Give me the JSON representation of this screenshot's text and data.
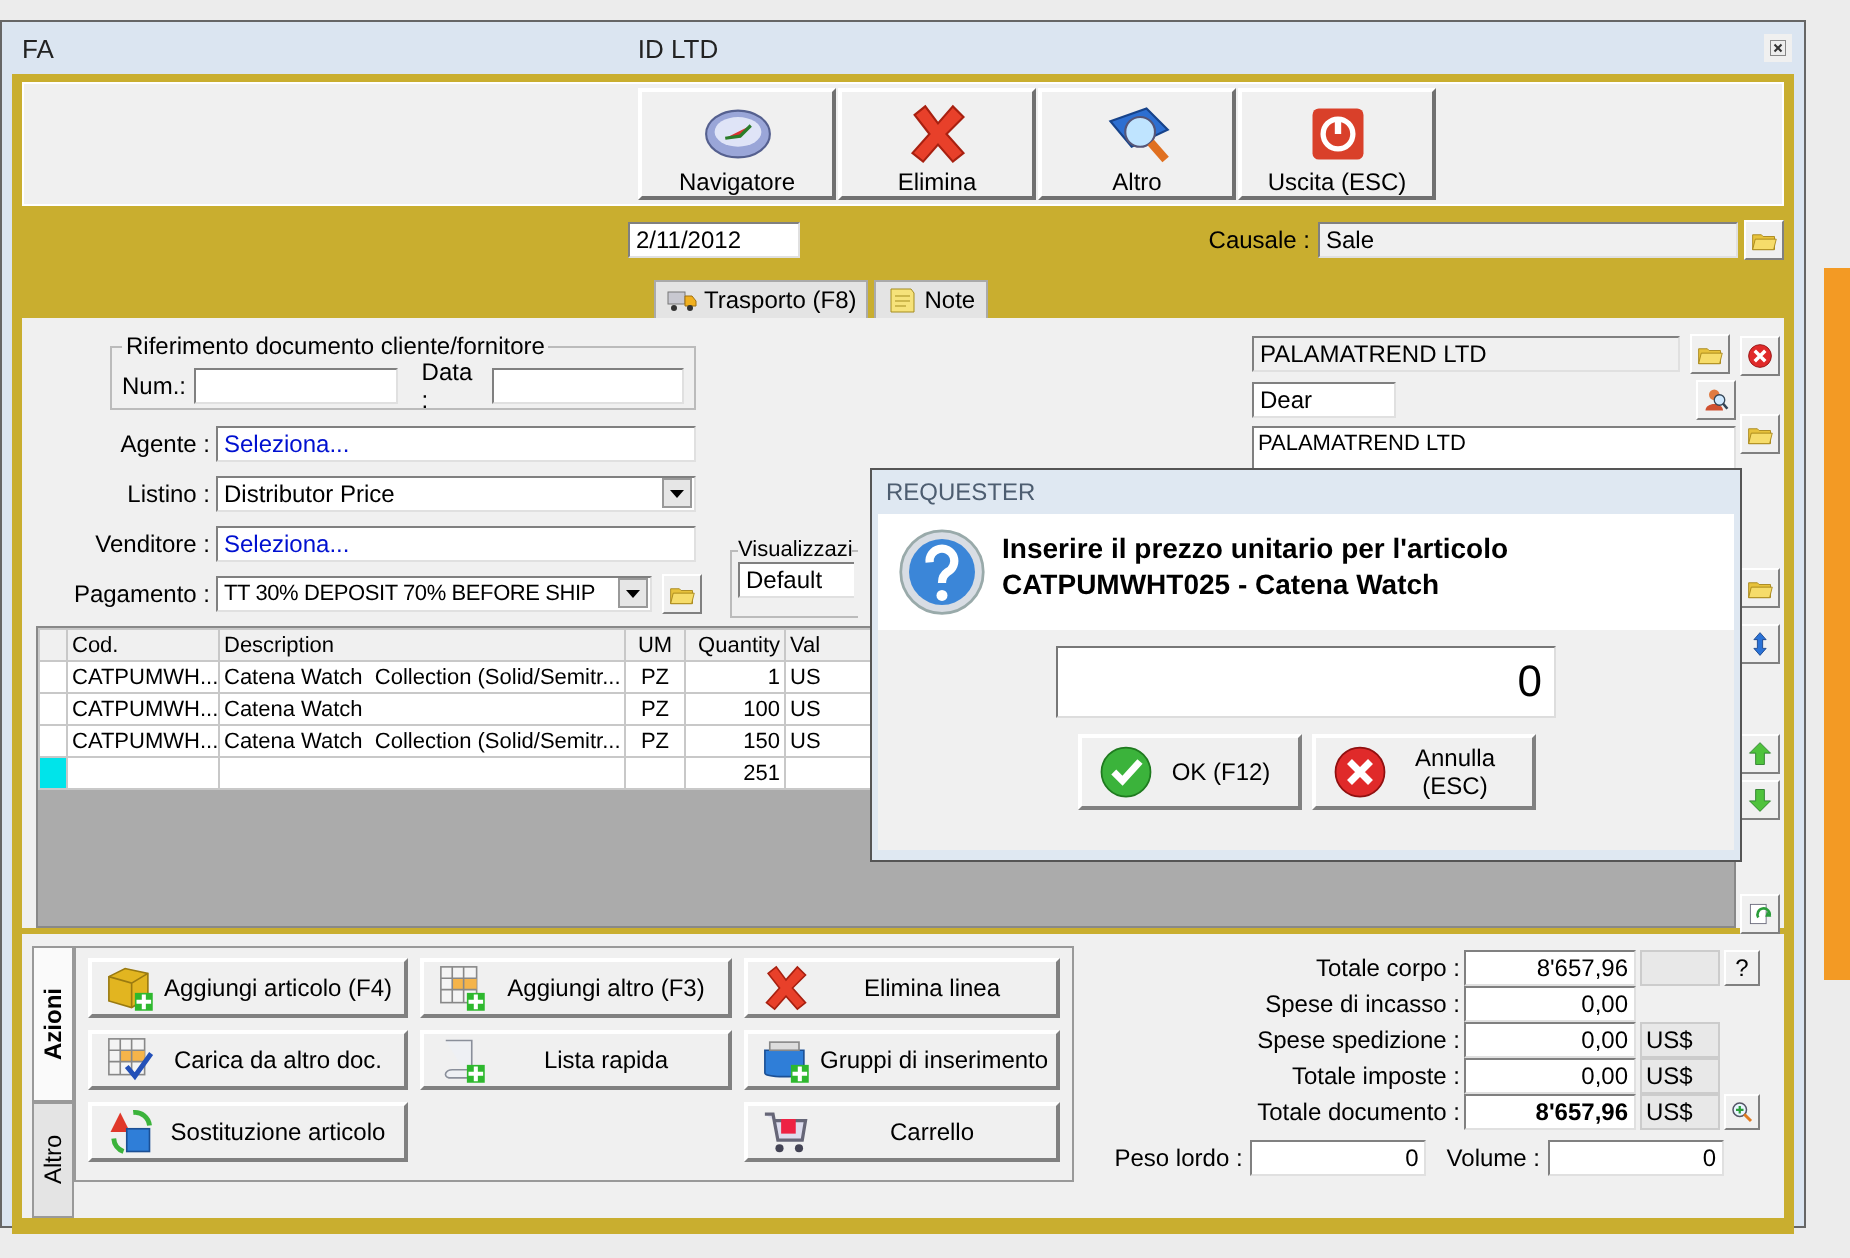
{
  "window": {
    "title_start": "FA",
    "title_end": "ID LTD"
  },
  "toolbar": [
    {
      "label": "Navigatore",
      "kind": "compass"
    },
    {
      "label": "Elimina",
      "kind": "cross"
    },
    {
      "label": "Altro",
      "kind": "book-search"
    },
    {
      "label": "Uscita (ESC)",
      "kind": "power"
    }
  ],
  "date_field": {
    "value": "2/11/2012"
  },
  "causale": {
    "label": "Causale :",
    "value": "Sale"
  },
  "tabs": [
    {
      "label": "Trasporto (F8)",
      "selected": false,
      "kind": "truck"
    },
    {
      "label": "Note",
      "selected": false,
      "kind": "note"
    }
  ],
  "document_reference": {
    "title": "Riferimento documento cliente/fornitore",
    "fields": [
      {
        "label": "Num.:"
      },
      {
        "label": "Data :"
      }
    ]
  },
  "form_rows": [
    {
      "label": "Agente :",
      "value": "Seleziona...",
      "kind": "link"
    },
    {
      "label": "Listino :",
      "value": "Distributor Price",
      "kind": "combo"
    },
    {
      "label": "Venditore :",
      "value": "Seleziona...",
      "kind": "link"
    },
    {
      "label": "Pagamento :",
      "value": "TT 30% DEPOSIT 70% BEFORE SHIP",
      "kind": "combo-folder"
    }
  ],
  "view_group": {
    "title": "Visualizzazi",
    "value": "Default"
  },
  "customer": {
    "name": "PALAMATREND LTD",
    "salutation": "Dear",
    "address_lines": [
      "PALAMATREND LTD"
    ]
  },
  "grid": {
    "columns": [
      "Cod.",
      "Description",
      "UM",
      "Quantity",
      "Val"
    ],
    "rows": [
      {
        "selected": false,
        "cells": [
          "CATPUMWH...",
          "Catena Watch  Collection (Solid/Semitr...",
          "PZ",
          "1",
          "US"
        ]
      },
      {
        "selected": false,
        "cells": [
          "CATPUMWH...",
          "Catena Watch",
          "PZ",
          "100",
          "US"
        ]
      },
      {
        "selected": false,
        "cells": [
          "CATPUMWH...",
          "Catena Watch  Collection (Solid/Semitr...",
          "PZ",
          "150",
          "US"
        ]
      }
    ],
    "total_row": {
      "selected": true,
      "quantity": "251"
    }
  },
  "dialog": {
    "title": "REQUESTER",
    "message_lines": [
      "Inserire il prezzo unitario per l'articolo",
      "CATPUMWHT025 - Catena Watch"
    ],
    "value": "0",
    "buttons": [
      {
        "label": "OK (F12)",
        "kind": "ok"
      },
      {
        "label": "Annulla (ESC)",
        "kind": "cancel"
      }
    ]
  },
  "side_tabs": [
    {
      "label": "Azioni",
      "selected": true
    },
    {
      "label": "Altro",
      "selected": false
    }
  ],
  "actions": [
    {
      "items": [
        {
          "label": "Aggiungi articolo (F4)",
          "kind": "box-plus"
        },
        {
          "label": "Carica da altro doc.",
          "kind": "grid-check"
        },
        {
          "label": "Sostituzione articolo",
          "kind": "cycle"
        }
      ]
    },
    {
      "items": [
        {
          "label": "Aggiungi altro (F3)",
          "kind": "grid-plus"
        },
        {
          "label": "Lista rapida",
          "kind": "scroll-plus"
        }
      ]
    },
    {
      "items": [
        {
          "label": "Elimina linea",
          "kind": "cross"
        },
        {
          "label": "Gruppi di inserimento",
          "kind": "basket-plus"
        },
        {
          "label": "Carrello",
          "kind": "cart"
        }
      ]
    }
  ],
  "totals": [
    {
      "label": "Totale corpo :",
      "value": "8'657,96",
      "bold": false,
      "kind": "help",
      "help_label": "?"
    },
    {
      "label": "Spese di incasso :",
      "value": "0,00",
      "bold": false,
      "kind": "plain"
    },
    {
      "label": "Spese spedizione :",
      "value": "0,00",
      "bold": false,
      "kind": "currency",
      "currency": "US$"
    },
    {
      "label": "Totale imposte :",
      "value": "0,00",
      "bold": false,
      "kind": "currency",
      "currency": "US$"
    },
    {
      "label": "Totale documento :",
      "value": "8'657,96",
      "bold": true,
      "kind": "currency-zoom",
      "currency": "US$"
    }
  ],
  "measures": [
    {
      "label": "Peso lordo :",
      "value": "0"
    },
    {
      "label": "Volume :",
      "value": "0"
    }
  ]
}
